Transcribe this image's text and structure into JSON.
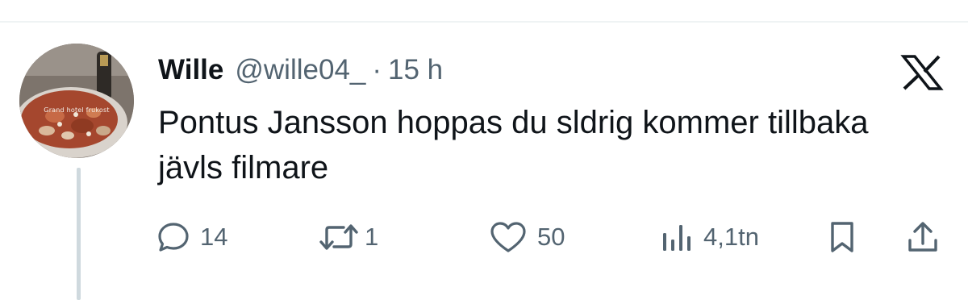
{
  "tweet": {
    "author": {
      "display_name": "Wille",
      "handle": "@wille04_",
      "avatar_caption": "Grand hotel frukost"
    },
    "separator": "·",
    "timestamp": "15 h",
    "text": "Pontus Jansson hoppas du sldrig kommer tillbaka jävls filmare"
  },
  "actions": {
    "replies": "14",
    "reposts": "1",
    "likes": "50",
    "views": "4,1tn"
  },
  "icons": {
    "brand": "x-logo-icon",
    "reply": "speech-bubble-icon",
    "repost": "repost-arrows-icon",
    "like": "heart-icon",
    "views": "bar-chart-icon",
    "bookmark": "bookmark-icon",
    "share": "share-upload-icon"
  },
  "colors": {
    "text_primary": "#0f1419",
    "text_secondary": "#536471",
    "divider": "#eff3f4",
    "thread_line": "#cfd9de"
  }
}
